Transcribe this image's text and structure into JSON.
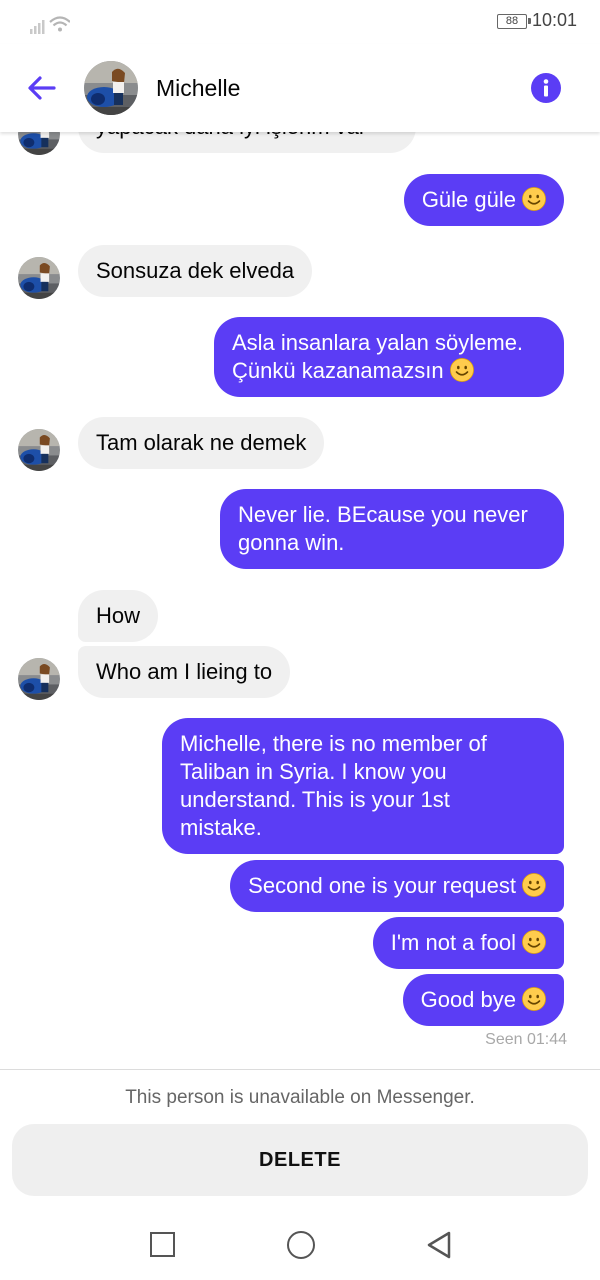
{
  "status": {
    "battery": "88",
    "time": "10:01"
  },
  "header": {
    "contact_name": "Michelle"
  },
  "messages": [
    {
      "dir": "in",
      "text": "yapacak daha iyi işlerim var"
    },
    {
      "dir": "out",
      "text": "Güle güle",
      "emoji": "smile"
    },
    {
      "dir": "in",
      "text": "Sonsuza dek elveda"
    },
    {
      "dir": "out",
      "lines": [
        "Asla insanlara yalan söyleme.",
        "Çünkü kazanamazsın"
      ],
      "emoji": "smile"
    },
    {
      "dir": "in",
      "text": "Tam olarak ne demek"
    },
    {
      "dir": "out",
      "lines": [
        "Never lie. BEcause you never",
        "gonna win."
      ]
    },
    {
      "dir": "in",
      "text": "How"
    },
    {
      "dir": "in",
      "text": "Who am I lieing to"
    },
    {
      "dir": "out",
      "lines": [
        "Michelle, there is no member of",
        "Taliban in Syria. I know you",
        "understand. This is your 1st",
        "mistake."
      ]
    },
    {
      "dir": "out",
      "text": "Second one is your request",
      "emoji": "smile"
    },
    {
      "dir": "out",
      "text": "I'm not a fool",
      "emoji": "smile"
    },
    {
      "dir": "out",
      "text": "Good bye",
      "emoji": "smile"
    }
  ],
  "seen_status": "Seen 01:44",
  "footer": {
    "unavailable_text": "This person is unavailable on Messenger.",
    "delete_label": "DELETE"
  },
  "icons": {
    "back": "arrow-left-icon",
    "info": "info-icon",
    "emoji": "slightly-smiling-face"
  },
  "colors": {
    "accent": "#5b3df5",
    "incoming_bubble": "#f0f0f0",
    "outgoing_text": "#ffffff"
  }
}
